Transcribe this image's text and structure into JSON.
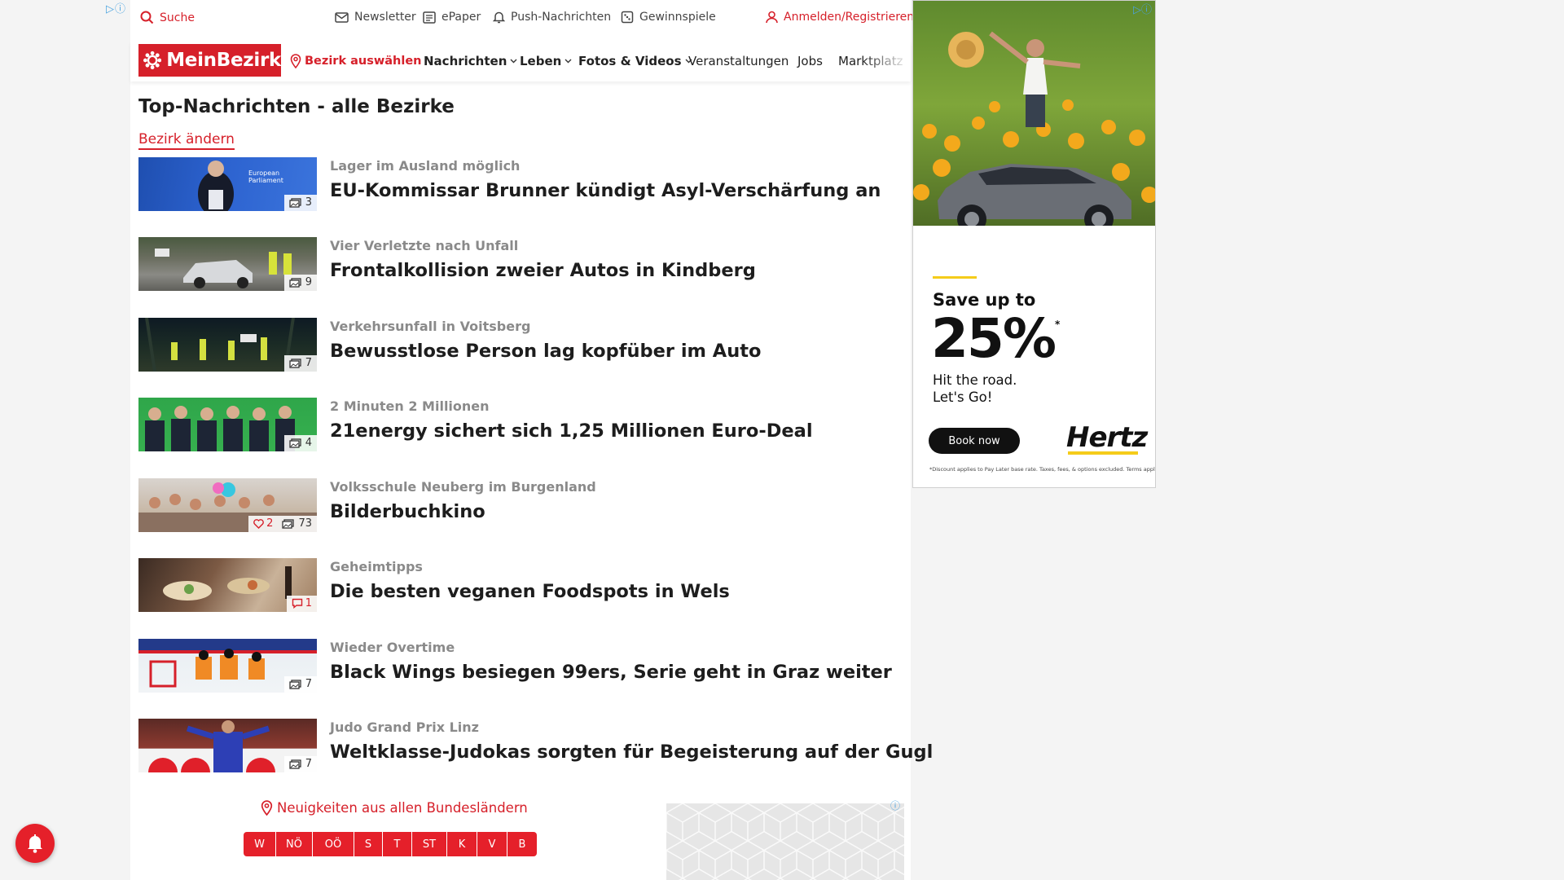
{
  "topbar": {
    "search_label": "Suche",
    "newsletter_label": "Newsletter",
    "epaper_label": "ePaper",
    "push_label": "Push-Nachrichten",
    "games_label": "Gewinnspiele",
    "login_label": "Anmelden/Registrieren"
  },
  "nav": {
    "logo_text": "MeinBezirk",
    "district_label": "Bezirk auswählen",
    "items": [
      "Nachrichten",
      "Leben",
      "Fotos & Videos",
      "Veranstaltungen",
      "Jobs",
      "Marktplatz"
    ]
  },
  "main": {
    "title": "Top-Nachrichten - alle Bezirke",
    "change_district": "Bezirk ändern",
    "articles": [
      {
        "kicker": "Lager im Ausland möglich",
        "headline": "EU-Kommissar Brunner kündigt Asyl-Verschärfung an",
        "photos": "3"
      },
      {
        "kicker": "Vier Verletzte nach Unfall",
        "headline": "Frontalkollision zweier Autos in Kindberg",
        "photos": "9"
      },
      {
        "kicker": "Verkehrsunfall in Voitsberg",
        "headline": "Bewusstlose Person lag kopfüber im Auto",
        "photos": "7"
      },
      {
        "kicker": "2 Minuten 2 Millionen",
        "headline": "21energy sichert sich 1,25 Millionen Euro-Deal",
        "photos": "4"
      },
      {
        "kicker": "Volksschule Neuberg im Burgenland",
        "headline": "Bilderbuchkino",
        "likes": "2",
        "photos": "73"
      },
      {
        "kicker": "Geheimtipps",
        "headline": "Die besten veganen Foodspots in Wels",
        "comments": "1"
      },
      {
        "kicker": "Wieder Overtime",
        "headline": "Black Wings besiegen 99ers, Serie geht in Graz weiter",
        "photos": "7"
      },
      {
        "kicker": "Judo Grand Prix Linz",
        "headline": "Weltklasse-Judokas sorgten für Begeisterung auf der Gugl",
        "photos": "7"
      }
    ],
    "regions_label": "Neuigkeiten aus allen Bundesländern",
    "regions": [
      "W",
      "NÖ",
      "OÖ",
      "S",
      "T",
      "ST",
      "K",
      "V",
      "B"
    ]
  },
  "ad": {
    "headline": "Save up to",
    "percent": "25%",
    "asterisk": "*",
    "line1": "Hit the road.",
    "line2": "Let's Go!",
    "button": "Book now",
    "brand": "Hertz",
    "fineprint": "*Discount applies to Pay Later base rate. Taxes, fees, & options excluded. Terms apply."
  },
  "colors": {
    "brand_red": "#d6202a",
    "ad_yellow": "#f5cc1a"
  }
}
